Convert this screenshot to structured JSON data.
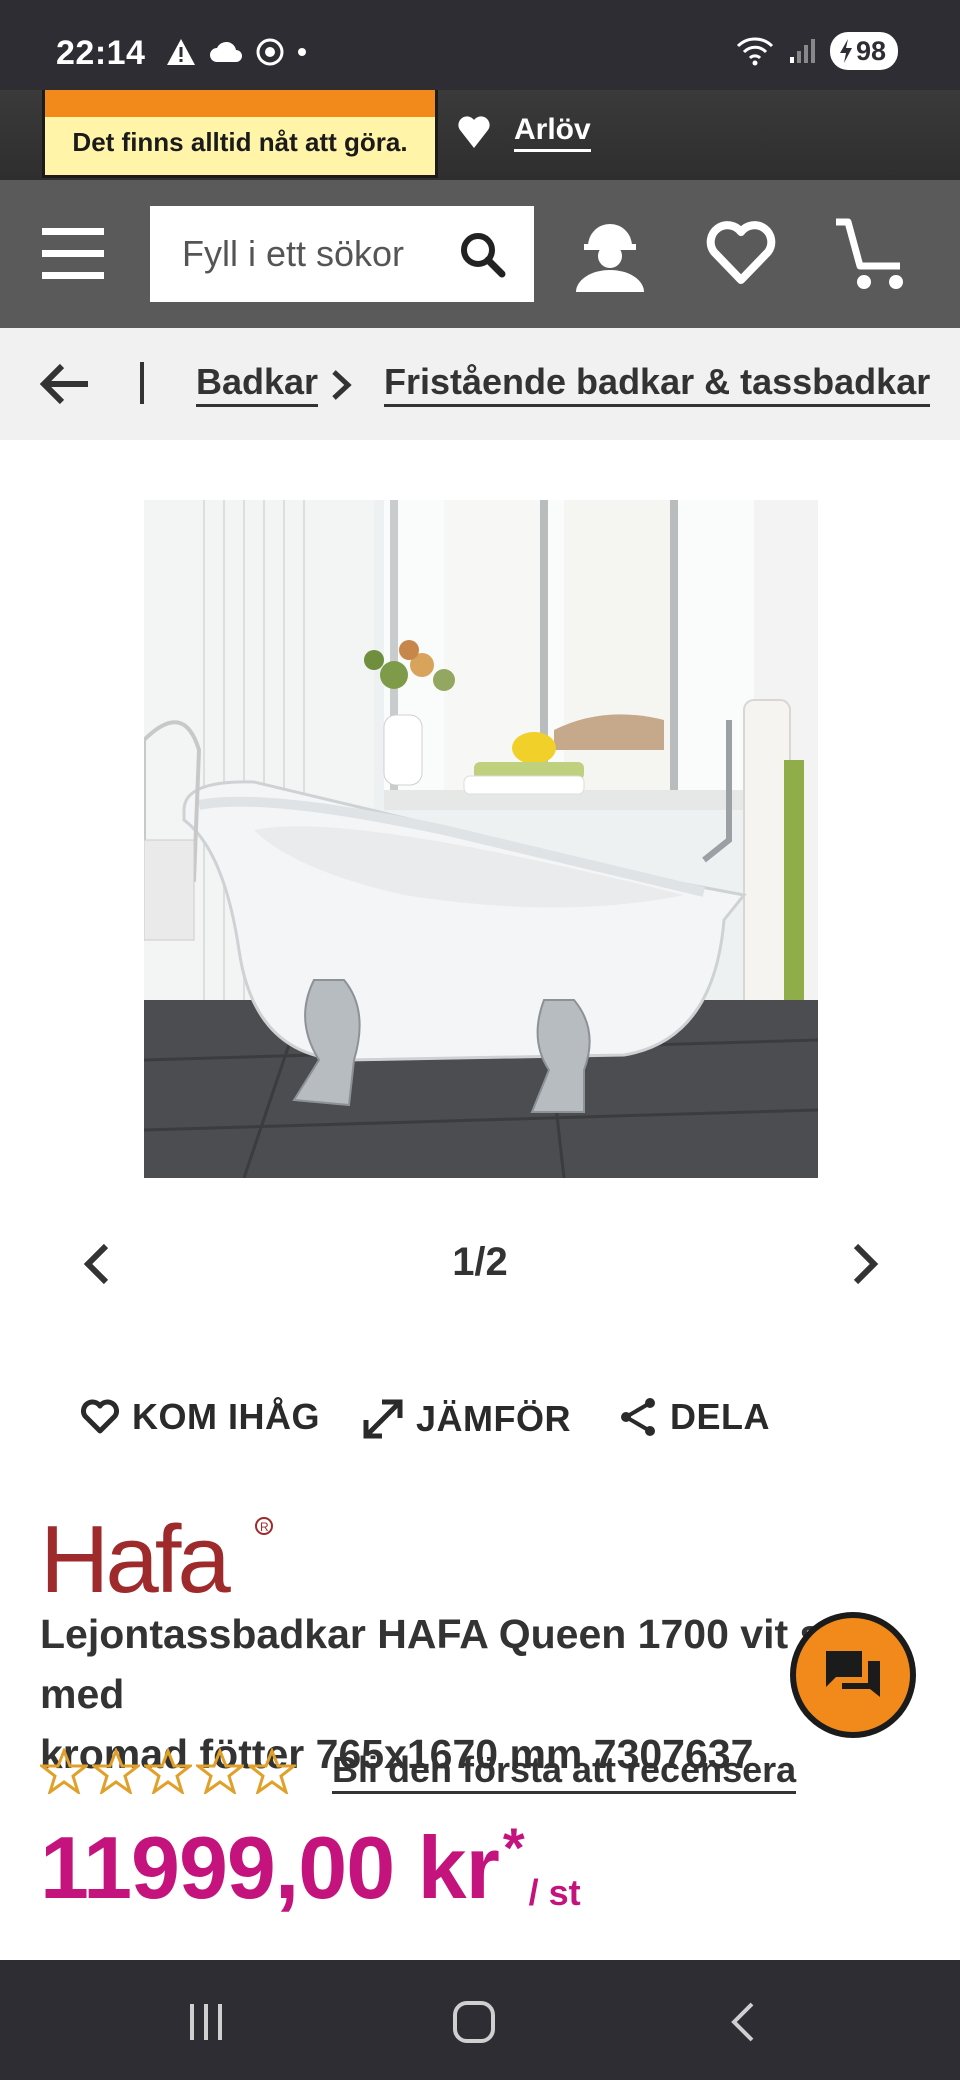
{
  "status_bar": {
    "time": "22:14",
    "battery": "98"
  },
  "header": {
    "tagline": "Det finns alltid nåt att göra.",
    "store": "Arlöv"
  },
  "search": {
    "placeholder": "Fyll i ett sökor"
  },
  "breadcrumb": {
    "items": [
      "Badkar",
      "Fristående badkar & tassbadkar"
    ]
  },
  "carousel": {
    "counter": "1/2"
  },
  "actions": {
    "remember": "KOM IHÅG",
    "compare": "JÄMFÖR",
    "share": "DELA"
  },
  "product": {
    "brand": "Hafa",
    "title": "Lejontassbadkar HAFA Queen 1700 vit slät med kromad fötter 765x1670 mm 7307637",
    "title_line1": "Lejontassbadkar HAFA Queen 1700 vit slät med",
    "title_line2": "kromad fötter 765x1670 mm 7307637",
    "rating_stars": 0,
    "review_link": "Bli den första att recensera",
    "price": "11999,00 kr",
    "price_asterisk": "*",
    "price_unit": "/ st"
  },
  "colors": {
    "price": "#c4137c",
    "accent_orange": "#f18a1a",
    "nav_bg": "#5a5a5a",
    "brand_red": "#9e2a2b"
  }
}
